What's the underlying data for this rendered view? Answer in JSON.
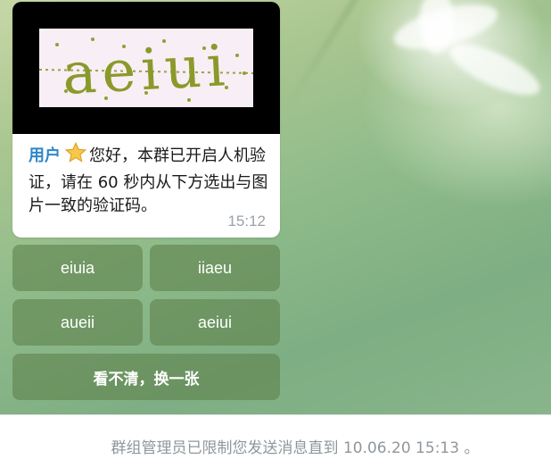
{
  "message": {
    "captcha_text": "aeiui",
    "user": "用户",
    "star_icon": "star-emoji",
    "text": "您好，本群已开启人机验证，请在 60 秒内从下方选出与图片一致的验证码。",
    "time": "15:12"
  },
  "keyboard": {
    "options": [
      "eiuia",
      "iiaeu",
      "aueii",
      "aeiui"
    ],
    "refresh_label": "看不清，换一张"
  },
  "footer": {
    "notice": "群组管理员已限制您发送消息直到 10.06.20 15:13 。"
  },
  "colors": {
    "user_name": "#2e86c9",
    "captcha_letters": "#8a9a2a",
    "button_bg": "rgba(96,130,78,0.62)"
  }
}
